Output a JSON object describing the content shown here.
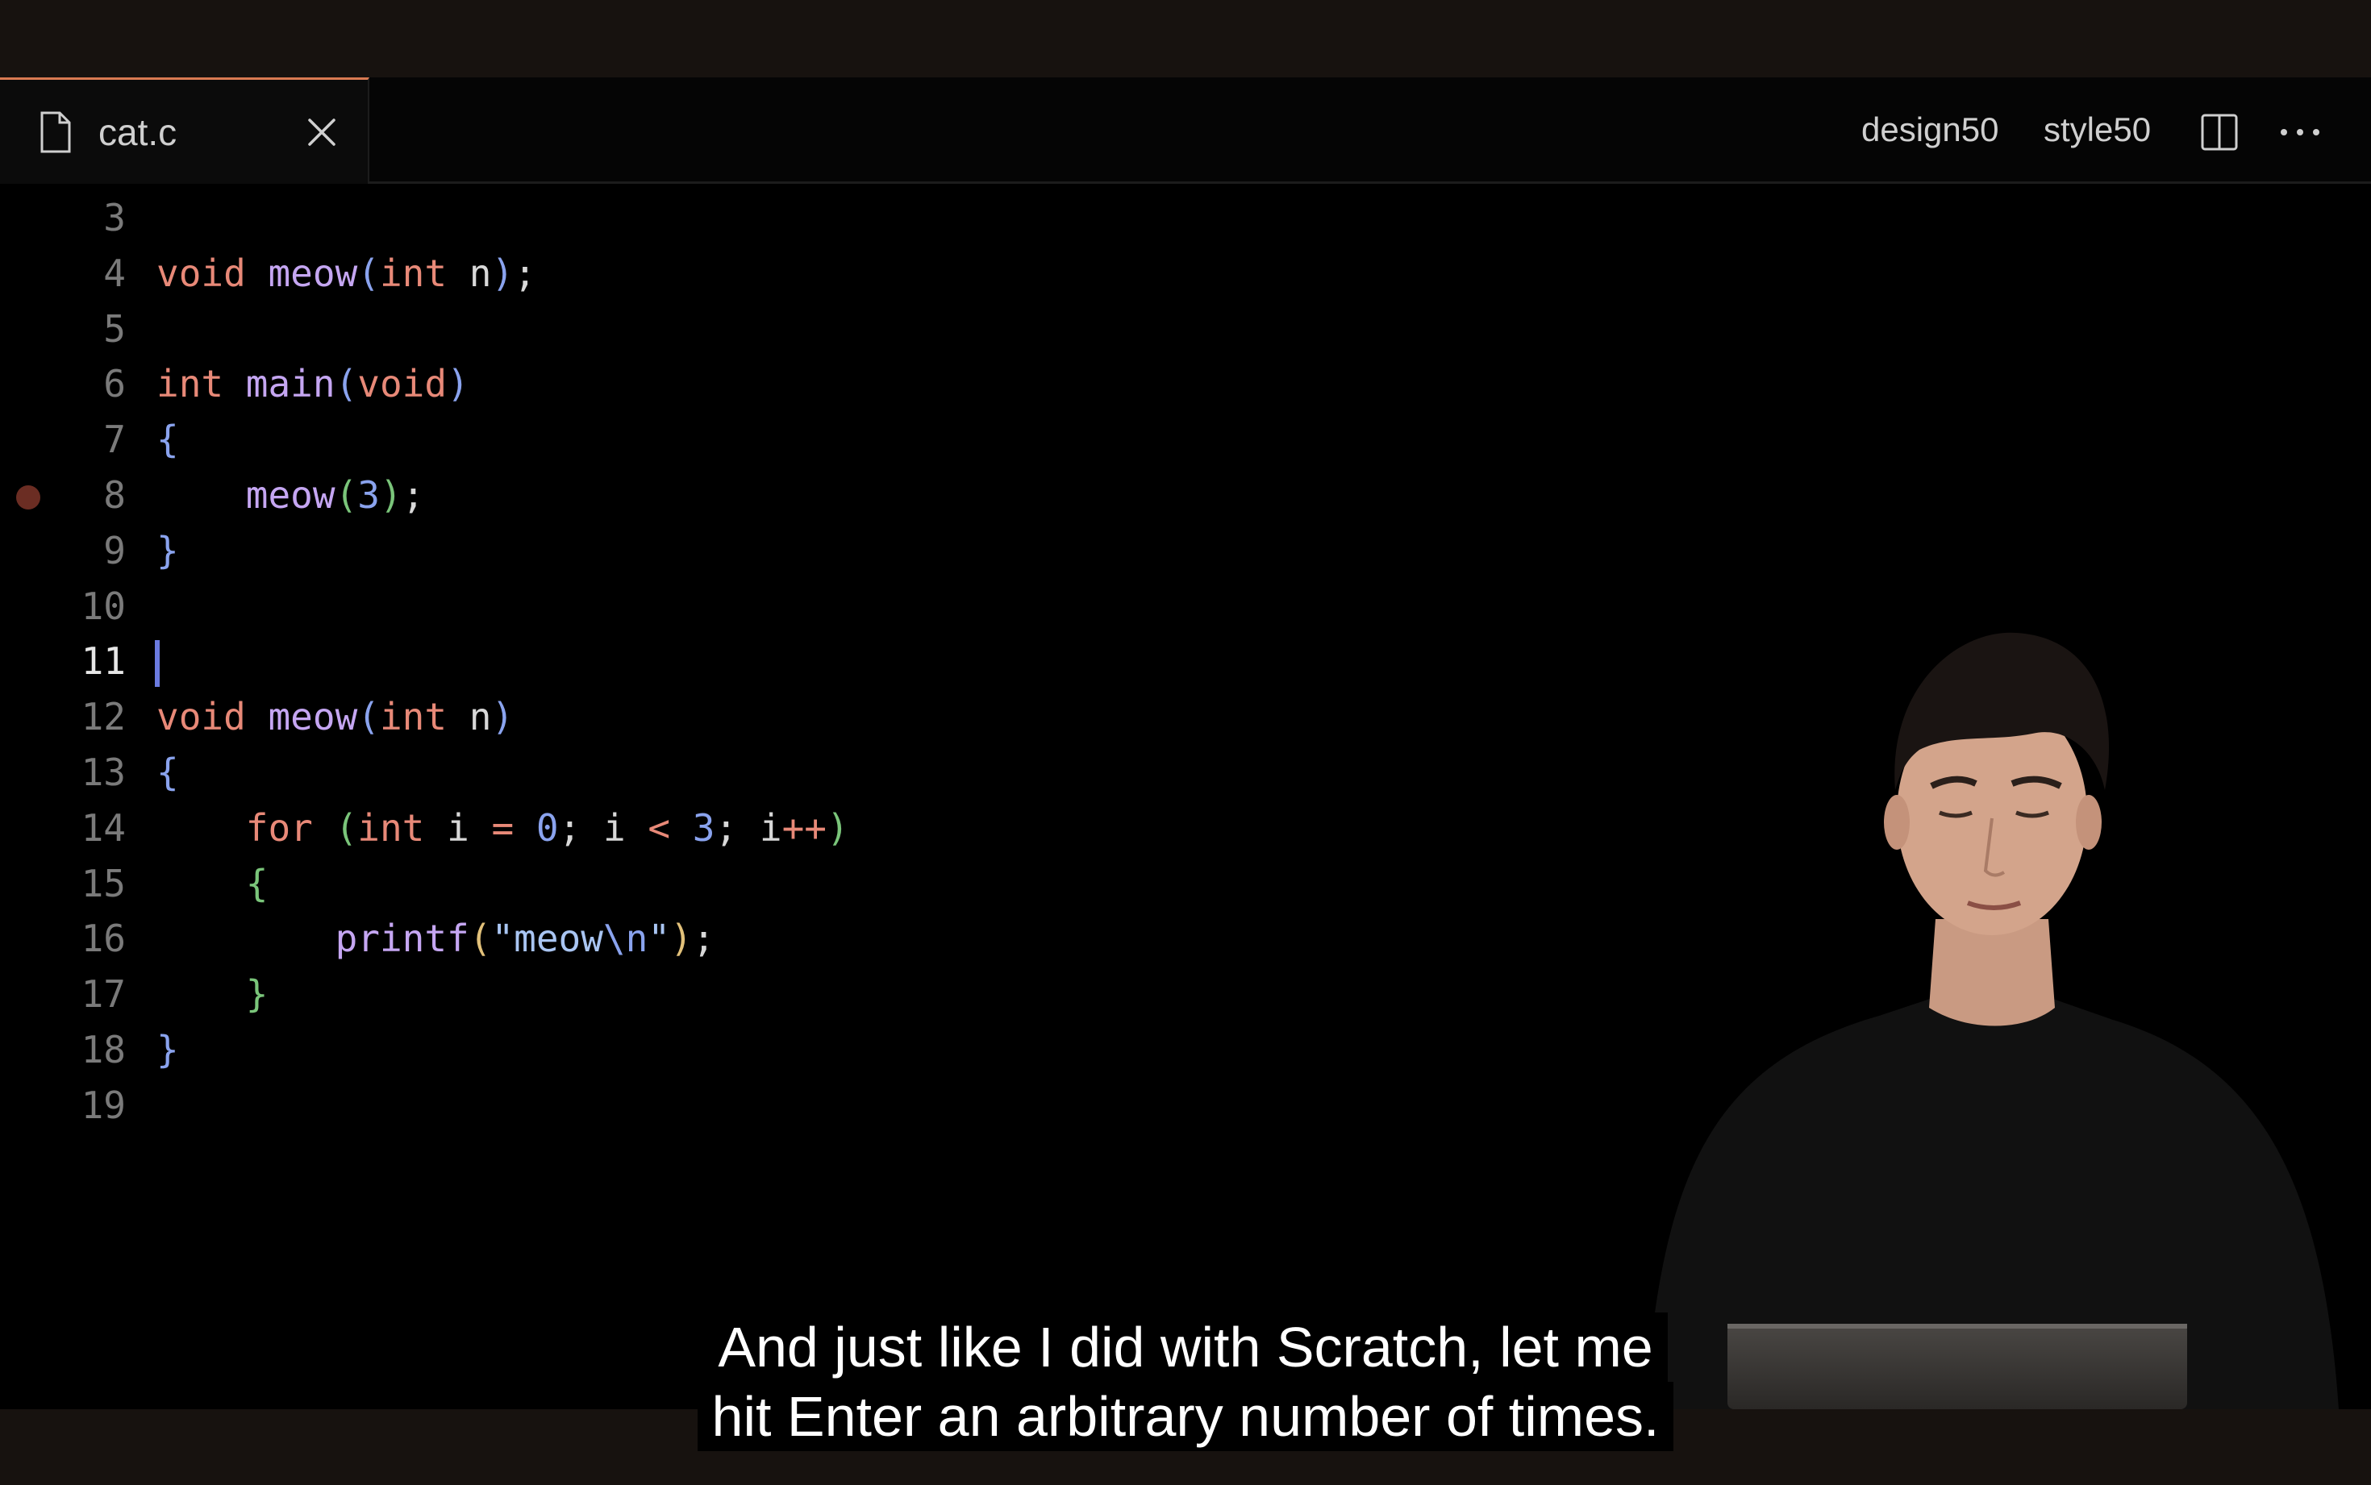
{
  "tab": {
    "file_name": "cat.c",
    "file_icon": "file-icon",
    "close_icon": "close-icon"
  },
  "actions": {
    "design": "design50",
    "style": "style50",
    "split_icon": "split-editor-icon",
    "more_icon": "more-icon"
  },
  "editor": {
    "active_line": 11,
    "breakpoint_line": 8,
    "lines": [
      {
        "number": "3",
        "tokens": []
      },
      {
        "number": "4",
        "tokens": [
          {
            "t": "void",
            "c": "kw"
          },
          {
            "t": " ",
            "c": "id"
          },
          {
            "t": "meow",
            "c": "fn"
          },
          {
            "t": "(",
            "c": "par"
          },
          {
            "t": "int",
            "c": "kw"
          },
          {
            "t": " n",
            "c": "id"
          },
          {
            "t": ")",
            "c": "par"
          },
          {
            "t": ";",
            "c": "id"
          }
        ]
      },
      {
        "number": "5",
        "tokens": []
      },
      {
        "number": "6",
        "tokens": [
          {
            "t": "int",
            "c": "kw"
          },
          {
            "t": " ",
            "c": "id"
          },
          {
            "t": "main",
            "c": "fn"
          },
          {
            "t": "(",
            "c": "par"
          },
          {
            "t": "void",
            "c": "kw"
          },
          {
            "t": ")",
            "c": "par"
          }
        ]
      },
      {
        "number": "7",
        "tokens": [
          {
            "t": "{",
            "c": "par"
          }
        ]
      },
      {
        "number": "8",
        "tokens": [
          {
            "t": "    ",
            "c": "id"
          },
          {
            "t": "meow",
            "c": "fn"
          },
          {
            "t": "(",
            "c": "par2"
          },
          {
            "t": "3",
            "c": "num"
          },
          {
            "t": ")",
            "c": "par2"
          },
          {
            "t": ";",
            "c": "id"
          }
        ]
      },
      {
        "number": "9",
        "tokens": [
          {
            "t": "}",
            "c": "par"
          }
        ]
      },
      {
        "number": "10",
        "tokens": []
      },
      {
        "number": "11",
        "tokens": []
      },
      {
        "number": "12",
        "tokens": [
          {
            "t": "void",
            "c": "kw"
          },
          {
            "t": " ",
            "c": "id"
          },
          {
            "t": "meow",
            "c": "fn"
          },
          {
            "t": "(",
            "c": "par"
          },
          {
            "t": "int",
            "c": "kw"
          },
          {
            "t": " n",
            "c": "id"
          },
          {
            "t": ")",
            "c": "par"
          }
        ]
      },
      {
        "number": "13",
        "tokens": [
          {
            "t": "{",
            "c": "par"
          }
        ]
      },
      {
        "number": "14",
        "tokens": [
          {
            "t": "    ",
            "c": "id"
          },
          {
            "t": "for",
            "c": "kw"
          },
          {
            "t": " ",
            "c": "id"
          },
          {
            "t": "(",
            "c": "par2"
          },
          {
            "t": "int",
            "c": "kw"
          },
          {
            "t": " i ",
            "c": "id"
          },
          {
            "t": "=",
            "c": "op"
          },
          {
            "t": " ",
            "c": "id"
          },
          {
            "t": "0",
            "c": "num"
          },
          {
            "t": "; i ",
            "c": "id"
          },
          {
            "t": "<",
            "c": "op"
          },
          {
            "t": " ",
            "c": "id"
          },
          {
            "t": "3",
            "c": "num"
          },
          {
            "t": "; i",
            "c": "id"
          },
          {
            "t": "++",
            "c": "op"
          },
          {
            "t": ")",
            "c": "par2"
          }
        ]
      },
      {
        "number": "15",
        "tokens": [
          {
            "t": "    ",
            "c": "id"
          },
          {
            "t": "{",
            "c": "par2"
          }
        ]
      },
      {
        "number": "16",
        "tokens": [
          {
            "t": "        ",
            "c": "id"
          },
          {
            "t": "printf",
            "c": "fn"
          },
          {
            "t": "(",
            "c": "paren-y"
          },
          {
            "t": "\"meow",
            "c": "str"
          },
          {
            "t": "\\n",
            "c": "esc"
          },
          {
            "t": "\"",
            "c": "str"
          },
          {
            "t": ")",
            "c": "paren-y"
          },
          {
            "t": ";",
            "c": "id"
          }
        ]
      },
      {
        "number": "17",
        "tokens": [
          {
            "t": "    ",
            "c": "id"
          },
          {
            "t": "}",
            "c": "par2"
          }
        ]
      },
      {
        "number": "18",
        "tokens": [
          {
            "t": "}",
            "c": "par"
          }
        ]
      },
      {
        "number": "19",
        "tokens": []
      }
    ]
  },
  "caption": {
    "line1": "And just like I did with Scratch, let me",
    "line2": "hit Enter an arbitrary number of times."
  },
  "colors": {
    "keyword": "#e88978",
    "function": "#c5a6f2",
    "bracket": "#8aa3ee",
    "accent_tab": "#d97a52",
    "cursor": "#6b7be0"
  }
}
